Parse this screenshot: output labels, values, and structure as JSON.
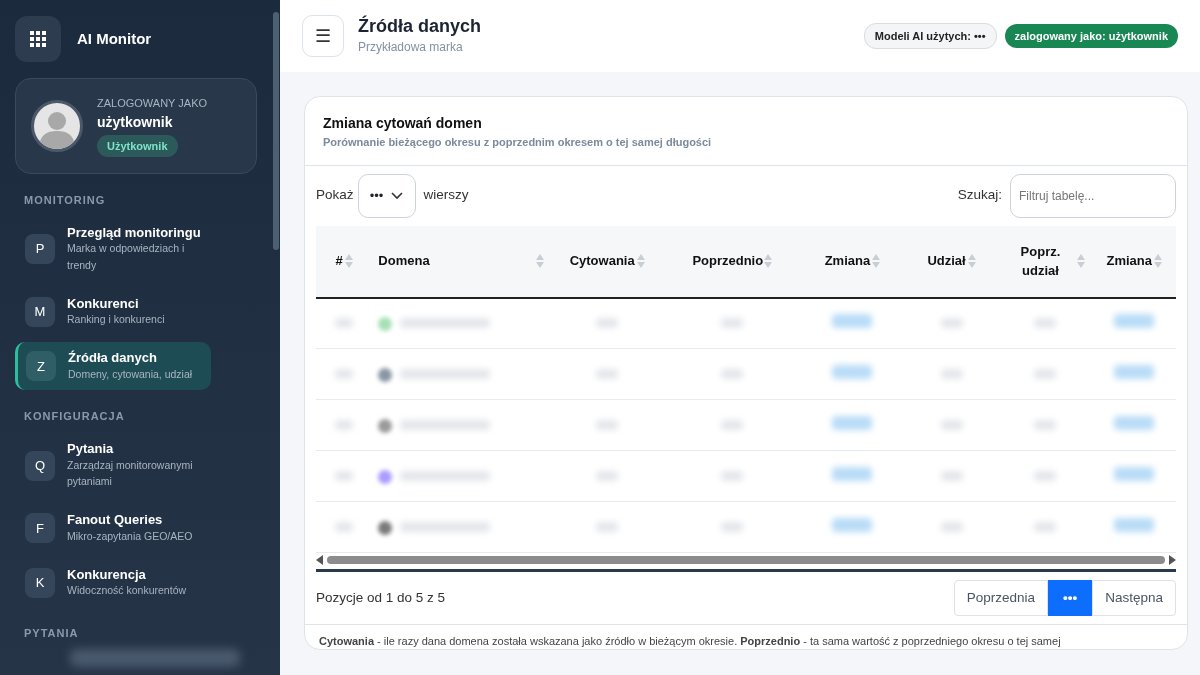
{
  "sidebar": {
    "brand": "AI Monitor",
    "user": {
      "caption": "ZALOGOWANY JAKO",
      "name": "użytkownik",
      "role": "Użytkownik"
    },
    "sections": [
      {
        "title": "MONITORING",
        "items": [
          {
            "letter": "P",
            "label": "Przegląd monitoringu",
            "hint": "Marka w odpowiedziach i trendy",
            "selected": false
          },
          {
            "letter": "M",
            "label": "Konkurenci",
            "hint": "Ranking i konkurenci",
            "selected": false
          },
          {
            "letter": "Z",
            "label": "Źródła danych",
            "hint": "Domeny, cytowania, udział",
            "selected": true
          }
        ]
      },
      {
        "title": "KONFIGURACJA",
        "items": [
          {
            "letter": "Q",
            "label": "Pytania",
            "hint": "Zarządzaj monitorowanymi pytaniami",
            "selected": false
          },
          {
            "letter": "F",
            "label": "Fanout Queries",
            "hint": "Mikro-zapytania GEO/AEO",
            "selected": false
          },
          {
            "letter": "K",
            "label": "Konkurencja",
            "hint": "Widoczność konkurentów",
            "selected": false
          }
        ]
      },
      {
        "title": "PYTANIA"
      }
    ]
  },
  "header": {
    "title": "Źródła danych",
    "subtitle": "Przykładowa marka",
    "menu_icon": "☰",
    "models_badge": "Modeli AI użytych: •••",
    "user_badge": "zalogowany jako: użytkownik"
  },
  "card": {
    "title": "Zmiana cytowań domen",
    "subtitle": "Porównanie bieżącego okresu z poprzednim okresem o tej samej długości",
    "length": {
      "label": "Pokaż",
      "value": "•••",
      "suffix": "wierszy"
    },
    "search": {
      "label": "Szukaj:",
      "placeholder": "Filtruj tabelę..."
    },
    "table": {
      "columns": [
        "#",
        "Domena",
        "Cytowania",
        "Poprzednio",
        "Zmiana",
        "Udział",
        "Poprz. udział",
        "Zmiana"
      ],
      "rows": [
        {
          "color": "#a7e0b5"
        },
        {
          "color": "#8a96a3"
        },
        {
          "color": "#9a9a9a"
        },
        {
          "color": "#a99cff"
        },
        {
          "color": "#7a7a7a"
        }
      ]
    },
    "info": "Pozycje od 1 do 5 z 5",
    "pagination": [
      {
        "label": "Poprzednia",
        "selected": false
      },
      {
        "label": "•••",
        "selected": true
      },
      {
        "label": "Następna",
        "selected": false
      }
    ],
    "footnote": "**Cytowania** - ile razy dana domena została wskazana jako źródło w bieżącym okresie. **Poprzednio** - ta sama wartość z poprzedniego okresu o tej samej"
  }
}
